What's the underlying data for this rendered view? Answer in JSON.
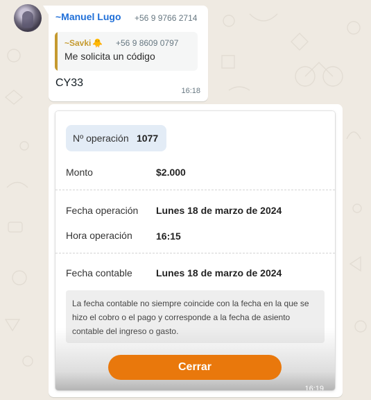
{
  "chat": {
    "message_1": {
      "sender_name": "~Manuel Lugo",
      "sender_phone": "+56 9 9766 2714",
      "quote": {
        "name": "~Savki",
        "emoji": "🐥",
        "phone": "+56 9 8609 0797",
        "text": "Me solicita un código"
      },
      "text": "CY33",
      "time": "16:18"
    },
    "message_2": {
      "time": "16:19",
      "receipt": {
        "operation_label": "Nº operación",
        "operation_value": "1077",
        "rows": [
          {
            "label": "Monto",
            "value": "$2.000"
          },
          {
            "label": "Fecha operación",
            "value": "Lunes 18 de marzo de 2024"
          },
          {
            "label": "Hora operación",
            "value": "16:15"
          },
          {
            "label": "Fecha contable",
            "value": "Lunes 18 de marzo de 2024"
          }
        ],
        "note": "La fecha contable no siempre coincide con la fecha en la que se hizo el cobro o el pago y corresponde a la fecha de asiento contable del ingreso o gasto.",
        "close_label": "Cerrar"
      }
    }
  },
  "colors": {
    "chat_background": "#efeae2",
    "sender_name": "#1f6fd8",
    "quote_accent": "#c59a2f",
    "button": "#e9780c"
  }
}
